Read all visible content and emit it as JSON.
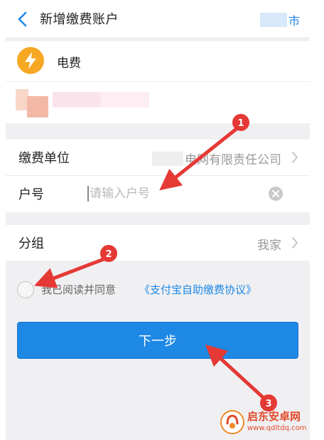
{
  "header": {
    "title": "新增缴费账户",
    "city": "市"
  },
  "bill_type": {
    "icon": "lightning-icon",
    "label": "电费",
    "icon_color": "#f7a823"
  },
  "form": {
    "unit": {
      "label": "缴费单位",
      "value": "电网有限责任公司"
    },
    "account": {
      "label": "户号",
      "placeholder": "请输入户号",
      "value": ""
    },
    "group": {
      "label": "分组",
      "value": "我家"
    }
  },
  "agreement": {
    "text": "我已阅读并同意",
    "link": "《支付宝自助缴费协议》",
    "checked": false
  },
  "next_button": {
    "label": "下一步"
  },
  "annotations": {
    "markers": [
      "1",
      "2",
      "3"
    ],
    "color": "#e53935"
  },
  "accent_color": "#1e88e5",
  "watermark": {
    "title": "启东安卓网",
    "url": "www.qdltdq.com"
  }
}
